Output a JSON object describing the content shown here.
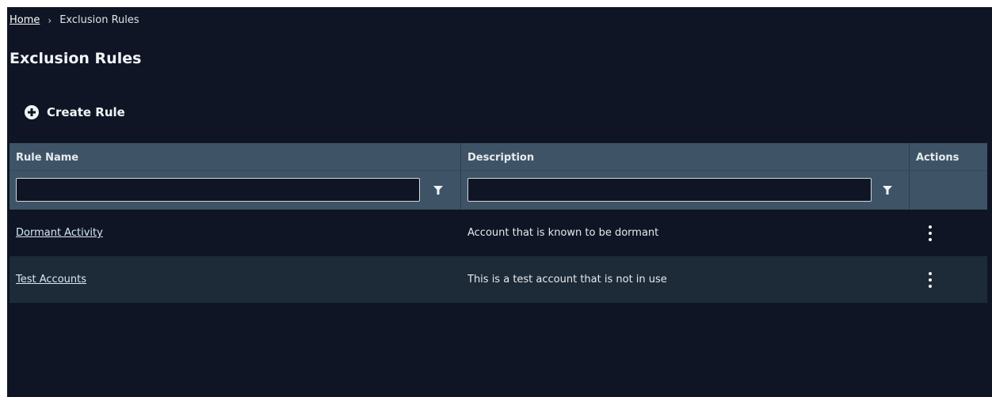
{
  "breadcrumb": {
    "home": "Home",
    "separator": "›",
    "current": "Exclusion Rules"
  },
  "page": {
    "title": "Exclusion Rules",
    "create_label": "Create Rule"
  },
  "table": {
    "columns": {
      "name": "Rule Name",
      "description": "Description",
      "actions": "Actions"
    },
    "filters": {
      "name_value": "",
      "description_value": ""
    },
    "rows": [
      {
        "name": "Dormant Activity",
        "description": "Account that is known to be dormant"
      },
      {
        "name": "Test Accounts",
        "description": "This is a test account that is not in use"
      }
    ]
  },
  "colors": {
    "background": "#0f1524",
    "header": "#3e5466",
    "row_alt": "#1d2a37",
    "link": "#d6eaf4"
  },
  "icons": {
    "create": "plus-circle-icon",
    "filter": "funnel-icon",
    "row_menu": "kebab-menu-icon"
  }
}
